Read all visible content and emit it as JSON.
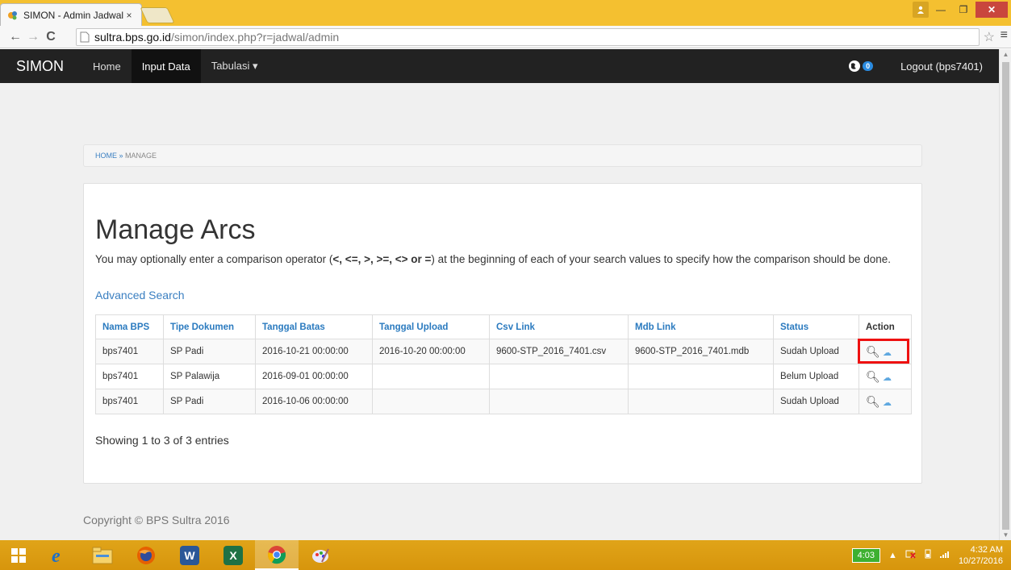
{
  "browser": {
    "tab_title": "SIMON - Admin Jadwal",
    "tab_close": "×",
    "url_host": "sultra.bps.go.id",
    "url_path": "/simon/index.php?r=jadwal/admin"
  },
  "navbar": {
    "brand": "SIMON",
    "items": [
      "Home",
      "Input Data",
      "Tabulasi ▾"
    ],
    "notification_count": "0",
    "logout": "Logout (bps7401)"
  },
  "breadcrumb": {
    "home": "HOME",
    "sep": " » ",
    "current": "MANAGE"
  },
  "main": {
    "title": "Manage Arcs",
    "help_pre": "You may optionally enter a comparison operator (",
    "help_ops": "<, <=, >, >=, <> or =",
    "help_post": ") at the beginning of each of your search values to specify how the comparison should be done.",
    "advanced_search": "Advanced Search",
    "summary": "Showing 1 to 3 of 3 entries"
  },
  "table": {
    "headers": [
      "Nama BPS",
      "Tipe Dokumen",
      "Tanggal Batas",
      "Tanggal Upload",
      "Csv Link",
      "Mdb Link",
      "Status",
      "Action"
    ],
    "rows": [
      [
        "bps7401",
        "SP Padi",
        "2016-10-21 00:00:00",
        "2016-10-20 00:00:00",
        "9600-STP_2016_7401.csv",
        "9600-STP_2016_7401.mdb",
        "Sudah Upload"
      ],
      [
        "bps7401",
        "SP Palawija",
        "2016-09-01 00:00:00",
        "",
        "",
        "",
        "Belum Upload"
      ],
      [
        "bps7401",
        "SP Padi",
        "2016-10-06 00:00:00",
        "",
        "",
        "",
        "Sudah Upload"
      ]
    ],
    "highlighted_action_row": 0
  },
  "footer": {
    "copyright": "Copyright © BPS Sultra 2016"
  },
  "taskbar": {
    "battery": "4:03",
    "time": "4:32 AM",
    "date": "10/27/2016"
  },
  "colors": {
    "accent": "#2a7abf",
    "navbar": "#222222",
    "highlight": "#ee1111",
    "taskbar": "#d99a10"
  }
}
